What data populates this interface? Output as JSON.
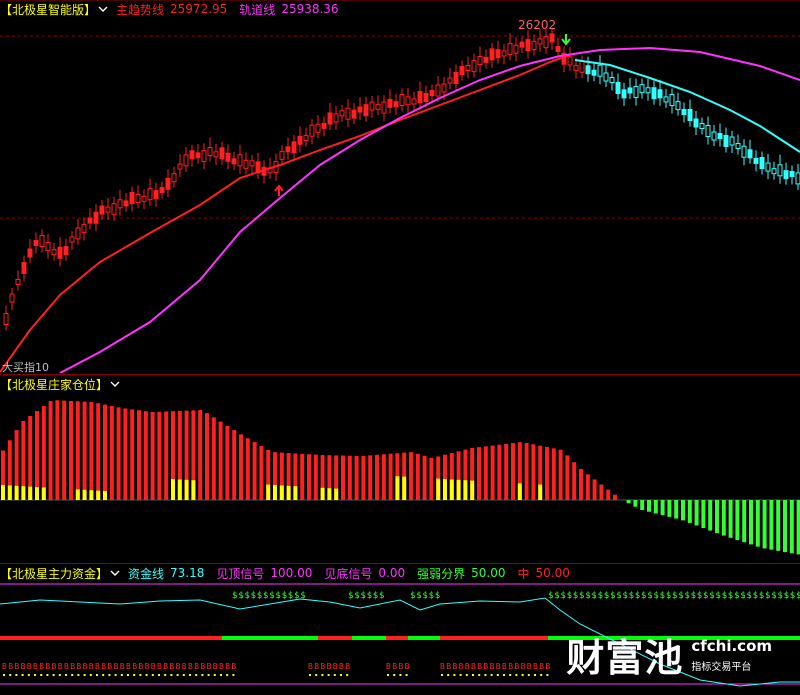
{
  "colors": {
    "yellow": "#ffff00",
    "red": "#ff2020",
    "magenta": "#ff33ff",
    "cyan": "#33ffff",
    "green": "#33ff33",
    "lime": "#00ff00",
    "grid": "#8b0000",
    "white": "#ffffff",
    "orange": "#ff6060"
  },
  "panel1": {
    "title": "【北极星智能版】",
    "main_trend_label": "主趋势线",
    "main_trend_value": "25972.95",
    "orbit_label": "轨道线",
    "orbit_value": "25938.36",
    "peak_label": "26202",
    "bottom_label": "大买指10"
  },
  "panel2": {
    "title": "【北极星庄家仓位】"
  },
  "panel3": {
    "title": "【北极星主力资金】",
    "fund_label": "资金线",
    "fund_value": "73.18",
    "top_signal_label": "见顶信号",
    "top_signal_value": "100.00",
    "bottom_signal_label": "见底信号",
    "bottom_signal_value": "0.00",
    "divide_label": "强弱分界",
    "divide_value": "50.00",
    "mid_label": "中",
    "mid_value": "50.00",
    "top_marker": "$",
    "bottom_marker": "B"
  },
  "watermark": {
    "name": "财富池",
    "url": "cfchi.com",
    "subtitle": "指标交易平台"
  }
}
